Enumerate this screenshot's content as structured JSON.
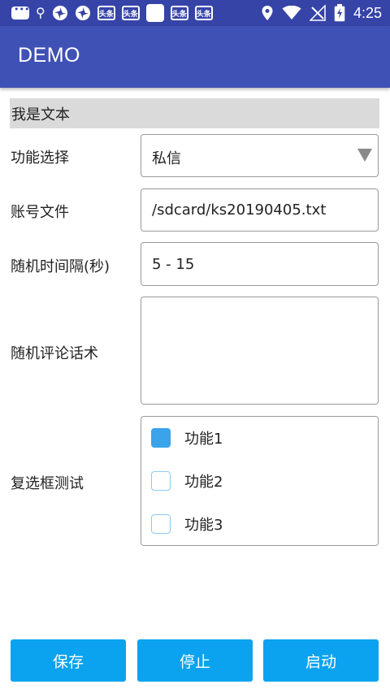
{
  "status_bar": {
    "time": "4:25",
    "left_icons": [
      "message-icon",
      "search-icon",
      "pinwheel-icon",
      "pinwheel-icon",
      "toutiao-icon",
      "toutiao-icon",
      "blank-app-icon",
      "toutiao-icon",
      "toutiao-icon"
    ],
    "toutiao_text": "头条",
    "right_icons": [
      "location-icon",
      "wifi-icon",
      "no-signal-icon",
      "battery-charging-icon"
    ]
  },
  "app_bar": {
    "title": "DEMO",
    "color": "#3f51b5"
  },
  "header_text": "我是文本",
  "form": {
    "function_select": {
      "label": "功能选择",
      "value": "私信"
    },
    "account_file": {
      "label": "账号文件",
      "value": "/sdcard/ks20190405.txt"
    },
    "interval": {
      "label": "随机时间隔(秒)",
      "value": "5 - 15"
    },
    "comment": {
      "label": "随机评论话术",
      "value": ""
    },
    "checkbox_test": {
      "label": "复选框测试",
      "options": [
        {
          "label": "功能1",
          "checked": true
        },
        {
          "label": "功能2",
          "checked": false
        },
        {
          "label": "功能3",
          "checked": false
        }
      ]
    }
  },
  "buttons": {
    "save": "保存",
    "stop": "停止",
    "start": "启动"
  },
  "colors": {
    "status_bar": "#3644a8",
    "app_bar": "#3f51b5",
    "button": "#0ba3ef",
    "checkbox_checked": "#3aa3ea"
  }
}
